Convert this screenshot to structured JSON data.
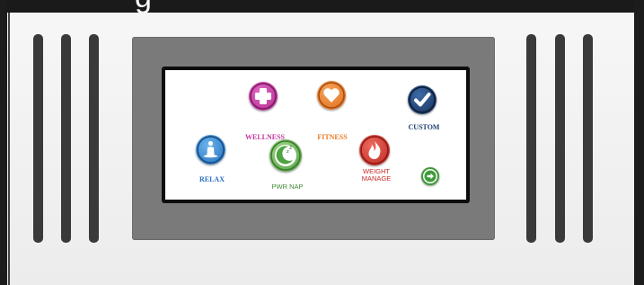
{
  "header": {
    "partial_text": "g"
  },
  "screen": {
    "apps": {
      "wellness": {
        "label": "WELLNESS",
        "icon": "plus-icon",
        "color": "#c2379e"
      },
      "fitness": {
        "label": "FITNESS",
        "icon": "heart-icon",
        "color": "#ea7a23"
      },
      "custom": {
        "label": "CUSTOM",
        "icon": "checkmark-icon",
        "color": "#1e3f6f"
      },
      "relax": {
        "label": "RELAX",
        "icon": "meditation-icon",
        "color": "#2b7fd0"
      },
      "pwr_nap": {
        "label": "PWR NAP",
        "icon": "sleep-icon",
        "color": "#4fa342"
      },
      "weight_manage": {
        "label_line1": "WEIGHT",
        "label_line2": "MANAGE",
        "icon": "flame-icon",
        "color": "#d3302a"
      }
    },
    "next_button": {
      "icon": "arrow-right-icon",
      "color": "#3f9a3a"
    }
  }
}
